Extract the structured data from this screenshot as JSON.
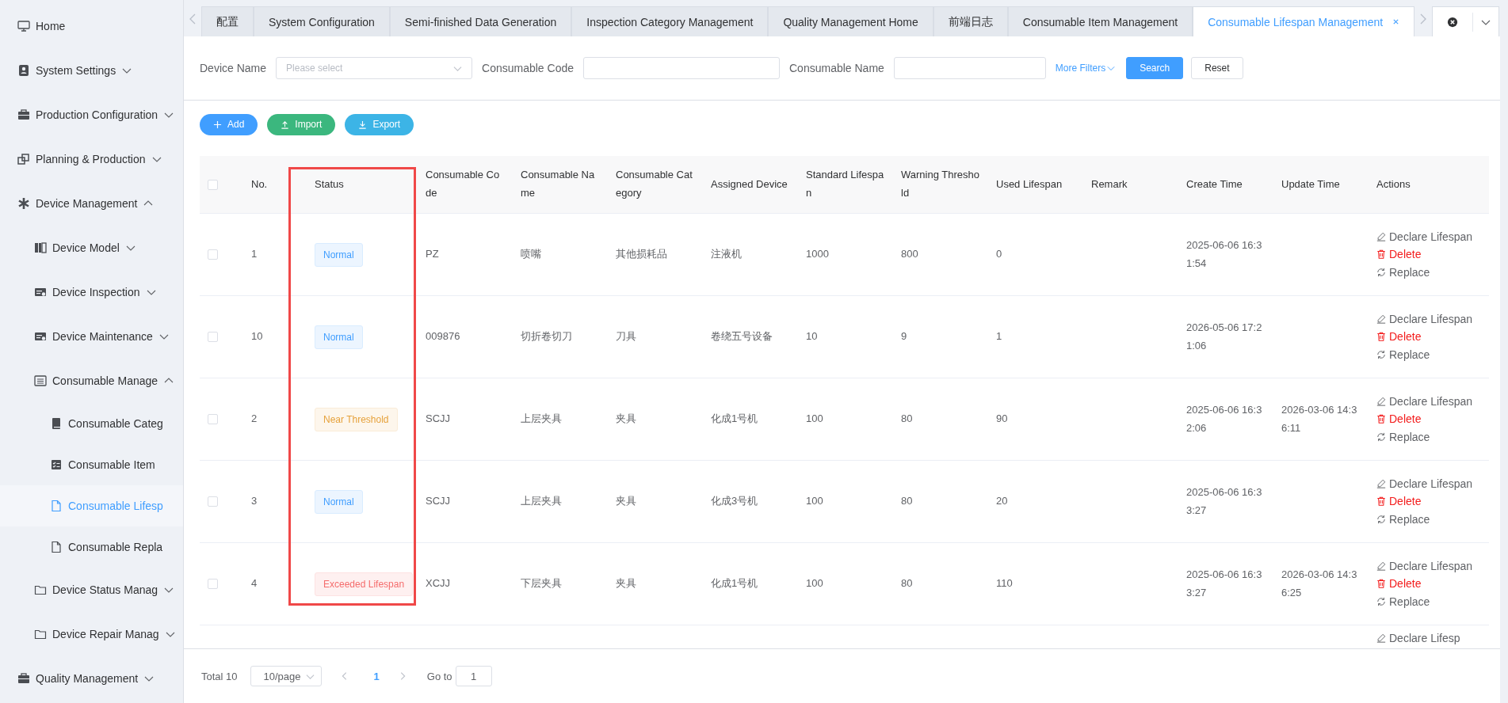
{
  "sidebar": {
    "items": [
      {
        "label": "Home",
        "selected": false
      },
      {
        "label": "System Settings",
        "selected": false,
        "expanded": false
      },
      {
        "label": "Production Configuration",
        "selected": false,
        "expanded": false
      },
      {
        "label": "Planning & Production",
        "selected": false,
        "expanded": false
      },
      {
        "label": "Device Management",
        "selected": false,
        "expanded": true,
        "children": [
          {
            "label": "Device Model",
            "selected": false,
            "expanded": false
          },
          {
            "label": "Device Inspection",
            "selected": false,
            "expanded": false
          },
          {
            "label": "Device Maintenance",
            "selected": false,
            "expanded": false
          },
          {
            "label": "Consumable Manage",
            "selected": false,
            "expanded": true,
            "children": [
              {
                "label": "Consumable Categ",
                "selected": false
              },
              {
                "label": "Consumable Item",
                "selected": false
              },
              {
                "label": "Consumable Lifesp",
                "selected": true
              },
              {
                "label": "Consumable Repla",
                "selected": false
              }
            ]
          },
          {
            "label": "Device Status Manag",
            "selected": false,
            "expanded": false
          },
          {
            "label": "Device Repair Manag",
            "selected": false,
            "expanded": false
          }
        ]
      },
      {
        "label": "Quality Management",
        "selected": false,
        "expanded": false
      }
    ]
  },
  "tabs": [
    {
      "label": "配置",
      "selected": false
    },
    {
      "label": "System Configuration",
      "selected": false
    },
    {
      "label": "Semi-finished Data Generation",
      "selected": false
    },
    {
      "label": "Inspection Category Management",
      "selected": false
    },
    {
      "label": "Quality Management Home",
      "selected": false
    },
    {
      "label": "前端日志",
      "selected": false
    },
    {
      "label": "Consumable Item Management",
      "selected": false
    },
    {
      "label": "Consumable Lifespan Management",
      "selected": true
    }
  ],
  "filters": [
    {
      "label": "Device Name",
      "kind": "select",
      "placeholder": "Please select"
    },
    {
      "label": "Consumable Code",
      "kind": "input"
    },
    {
      "label": "Consumable Name",
      "kind": "input"
    }
  ],
  "more_filters": "More Filters",
  "filter_buttons": [
    {
      "label": "Search",
      "kind": "primary"
    },
    {
      "label": "Reset",
      "kind": "default"
    }
  ],
  "toolbar": [
    {
      "label": "Add",
      "kind": "add"
    },
    {
      "label": "Import",
      "kind": "import"
    },
    {
      "label": "Export",
      "kind": "export"
    }
  ],
  "table": {
    "header_checkbox": {
      "checked": false
    },
    "columns": [
      "No.",
      "Status",
      "Consumable Code",
      "Consumable Name",
      "Consumable Category",
      "Assigned Device",
      "Standard Lifespan",
      "Warning Threshold",
      "Used Lifespan",
      "Remark",
      "Create Time",
      "Update Time",
      "Actions"
    ],
    "rows": [
      {
        "checked": false,
        "no": "1",
        "status": {
          "label": "Normal",
          "kind": "normal"
        },
        "code": "PZ",
        "name": "喷嘴",
        "category": "其他损耗品",
        "device": "注液机",
        "standard": "1000",
        "warning": "800",
        "used": "0",
        "create_time": "2025-06-06 16:31:54",
        "actions": [
          {
            "label": "Declare Lifespan",
            "kind": "declare"
          },
          {
            "label": "Delete",
            "kind": "delete"
          },
          {
            "label": "Replace",
            "kind": "replace"
          }
        ]
      },
      {
        "checked": false,
        "no": "10",
        "status": {
          "label": "Normal",
          "kind": "normal"
        },
        "code": "009876",
        "name": "切折卷切刀",
        "category": "刀具",
        "device": "卷绕五号设备",
        "standard": "10",
        "warning": "9",
        "used": "1",
        "create_time": "2026-05-06 17:21:06",
        "actions": [
          {
            "label": "Declare Lifespan",
            "kind": "declare"
          },
          {
            "label": "Delete",
            "kind": "delete"
          },
          {
            "label": "Replace",
            "kind": "replace"
          }
        ]
      },
      {
        "checked": false,
        "no": "2",
        "status": {
          "label": "Near Threshold",
          "kind": "warning"
        },
        "code": "SCJJ",
        "name": "上层夹具",
        "category": "夹具",
        "device": "化成1号机",
        "standard": "100",
        "warning": "80",
        "used": "90",
        "create_time": "2025-06-06 16:32:06",
        "update_time": "2026-03-06 14:36:11",
        "actions": [
          {
            "label": "Declare Lifespan",
            "kind": "declare"
          },
          {
            "label": "Delete",
            "kind": "delete"
          },
          {
            "label": "Replace",
            "kind": "replace"
          }
        ]
      },
      {
        "checked": false,
        "no": "3",
        "status": {
          "label": "Normal",
          "kind": "normal"
        },
        "code": "SCJJ",
        "name": "上层夹具",
        "category": "夹具",
        "device": "化成3号机",
        "standard": "100",
        "warning": "80",
        "used": "20",
        "create_time": "2025-06-06 16:33:27",
        "actions": [
          {
            "label": "Declare Lifespan",
            "kind": "declare"
          },
          {
            "label": "Delete",
            "kind": "delete"
          },
          {
            "label": "Replace",
            "kind": "replace"
          }
        ]
      },
      {
        "checked": false,
        "no": "4",
        "status": {
          "label": "Exceeded Lifespan",
          "kind": "danger"
        },
        "code": "XCJJ",
        "name": "下层夹具",
        "category": "夹具",
        "device": "化成1号机",
        "standard": "100",
        "warning": "80",
        "used": "110",
        "create_time": "2025-06-06 16:33:27",
        "update_time": "2026-03-06 14:36:25",
        "actions": [
          {
            "label": "Declare Lifespan",
            "kind": "declare"
          },
          {
            "label": "Delete",
            "kind": "delete"
          },
          {
            "label": "Replace",
            "kind": "replace"
          }
        ]
      }
    ],
    "partial_row": {
      "action": "Declare Lifesp"
    }
  },
  "pagination": {
    "total": "Total 10",
    "page_size": "10/page",
    "pages": [
      {
        "label": "1",
        "selected": true
      }
    ],
    "goto_label": "Go to",
    "goto_value": "1"
  }
}
